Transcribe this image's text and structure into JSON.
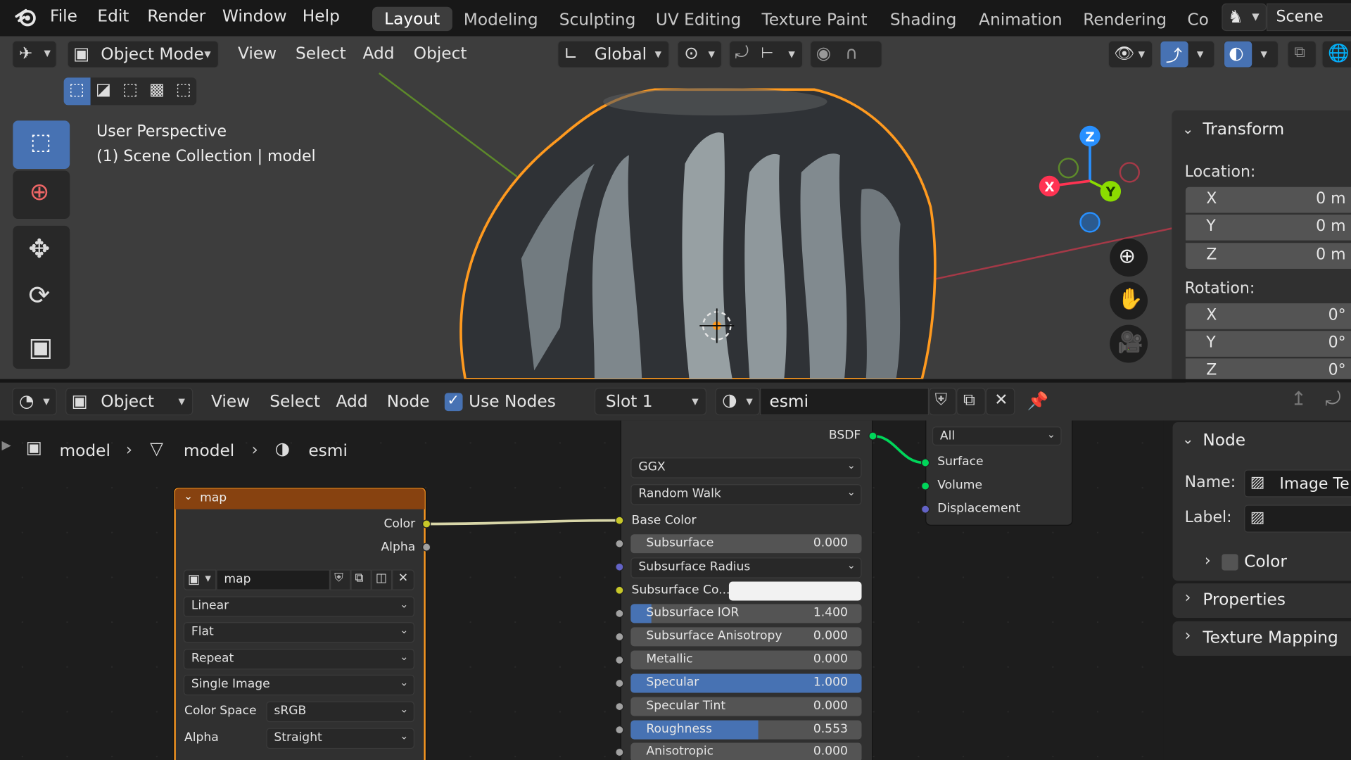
{
  "top_menu": {
    "items": [
      "File",
      "Edit",
      "Render",
      "Window",
      "Help"
    ],
    "workspaces": [
      "Layout",
      "Modeling",
      "Sculpting",
      "UV Editing",
      "Texture Paint",
      "Shading",
      "Animation",
      "Rendering",
      "Co"
    ],
    "active_workspace": "Layout",
    "scene_label": "Scene"
  },
  "viewport_header": {
    "mode": "Object Mode",
    "menus": [
      "View",
      "Select",
      "Add",
      "Object"
    ],
    "orientation": "Global"
  },
  "viewport": {
    "overlay_line1": "User Perspective",
    "overlay_line2": "(1) Scene Collection | model",
    "gizmo_axes": {
      "x": "X",
      "y": "Y",
      "z": "Z"
    },
    "colors": {
      "x_axis": "#ff3352",
      "y_axis": "#8bdc00",
      "z_axis": "#2890ff",
      "selection": "#ff9a1f"
    }
  },
  "transform_panel": {
    "title": "Transform",
    "location_label": "Location:",
    "location": [
      {
        "axis": "X",
        "value": "0 m"
      },
      {
        "axis": "Y",
        "value": "0 m"
      },
      {
        "axis": "Z",
        "value": "0 m"
      }
    ],
    "rotation_label": "Rotation:",
    "rotation": [
      {
        "axis": "X",
        "value": "0°"
      },
      {
        "axis": "Y",
        "value": "0°"
      },
      {
        "axis": "Z",
        "value": "0°"
      }
    ]
  },
  "node_header": {
    "mode": "Object",
    "menus": [
      "View",
      "Select",
      "Add",
      "Node"
    ],
    "use_nodes_label": "Use Nodes",
    "use_nodes_checked": true,
    "slot": "Slot 1",
    "material": "esmi"
  },
  "breadcrumb": [
    "model",
    "model",
    "esmi"
  ],
  "image_node": {
    "title": "map",
    "outputs": [
      "Color",
      "Alpha"
    ],
    "image_name": "map",
    "interpolation": "Linear",
    "projection": "Flat",
    "extension": "Repeat",
    "source": "Single Image",
    "color_space_label": "Color Space",
    "color_space": "sRGB",
    "alpha_label": "Alpha",
    "alpha": "Straight"
  },
  "bsdf_node": {
    "output": "BSDF",
    "distribution": "GGX",
    "subsurface_method": "Random Walk",
    "base_color_label": "Base Color",
    "subsurface_color_label": "Subsurface Co...",
    "subsurface_radius_label": "Subsurface Radius",
    "fields": [
      {
        "label": "Subsurface",
        "value": "0.000",
        "fraction": 0
      },
      {
        "label": "Subsurface IOR",
        "value": "1.400",
        "fraction": 0.09
      },
      {
        "label": "Subsurface Anisotropy",
        "value": "0.000",
        "fraction": 0
      },
      {
        "label": "Metallic",
        "value": "0.000",
        "fraction": 0
      },
      {
        "label": "Specular",
        "value": "1.000",
        "fraction": 1.0
      },
      {
        "label": "Specular Tint",
        "value": "0.000",
        "fraction": 0
      },
      {
        "label": "Roughness",
        "value": "0.553",
        "fraction": 0.553
      },
      {
        "label": "Anisotropic",
        "value": "0.000",
        "fraction": 0
      }
    ]
  },
  "output_node": {
    "target": "All",
    "inputs": [
      "Surface",
      "Volume",
      "Displacement"
    ]
  },
  "node_panel": {
    "title": "Node",
    "name_label": "Name:",
    "name_value": "Image Te",
    "label_label": "Label:",
    "color_label": "Color",
    "properties_label": "Properties",
    "texture_mapping_label": "Texture Mapping"
  }
}
